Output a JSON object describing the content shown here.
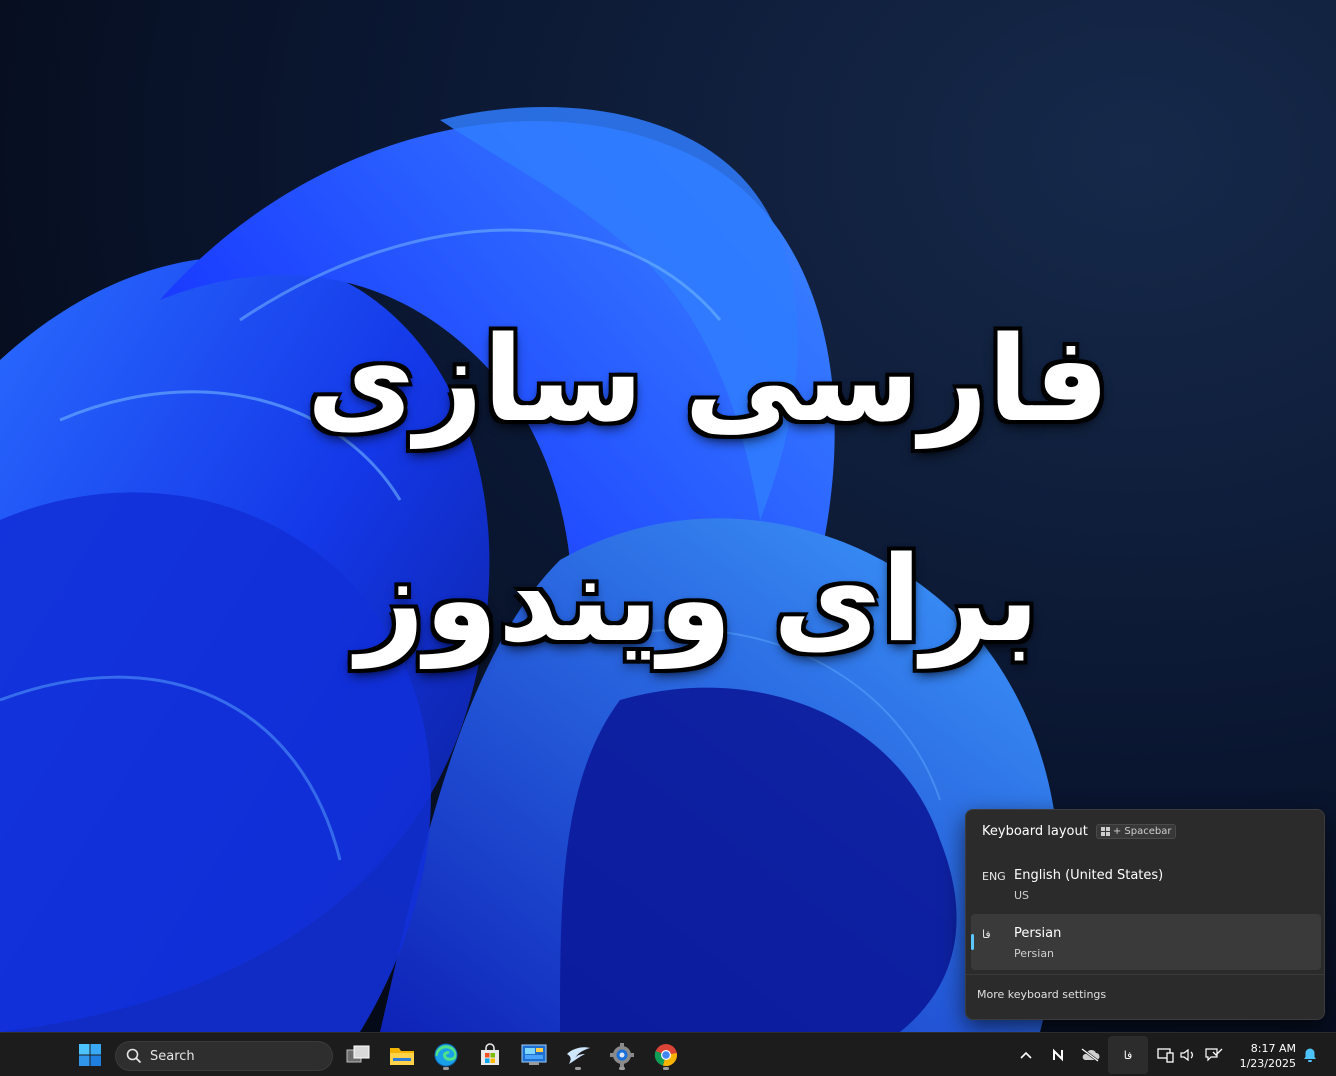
{
  "overlay": {
    "line1": "فارسی سازی",
    "line2": "برای ویندوز"
  },
  "keyboard_flyout": {
    "title": "Keyboard layout",
    "shortcut_suffix": "+ Spacebar",
    "items": [
      {
        "code": "ENG",
        "name": "English (United States)",
        "layout": "US",
        "selected": false
      },
      {
        "code": "فا",
        "name": "Persian",
        "layout": "Persian",
        "selected": true
      }
    ],
    "more_settings": "More keyboard settings"
  },
  "taskbar": {
    "search_label": "Search",
    "apps": [
      {
        "name": "task-view",
        "running": false
      },
      {
        "name": "file-explorer",
        "running": false
      },
      {
        "name": "edge",
        "running": true
      },
      {
        "name": "microsoft-store",
        "running": false
      },
      {
        "name": "control-panel",
        "running": false
      },
      {
        "name": "swift-app",
        "running": true
      },
      {
        "name": "settings",
        "running": true
      },
      {
        "name": "chrome",
        "running": true
      }
    ],
    "tray": {
      "language_indicator": "فا"
    },
    "clock": {
      "time": "8:17 AM",
      "date": "1/23/2025"
    }
  },
  "colors": {
    "accent": "#5cc6ff",
    "wallpaper_blue": "#1a3cff",
    "flyout_bg": "#2b2b2b",
    "taskbar_bg": "#1c1c1c"
  }
}
